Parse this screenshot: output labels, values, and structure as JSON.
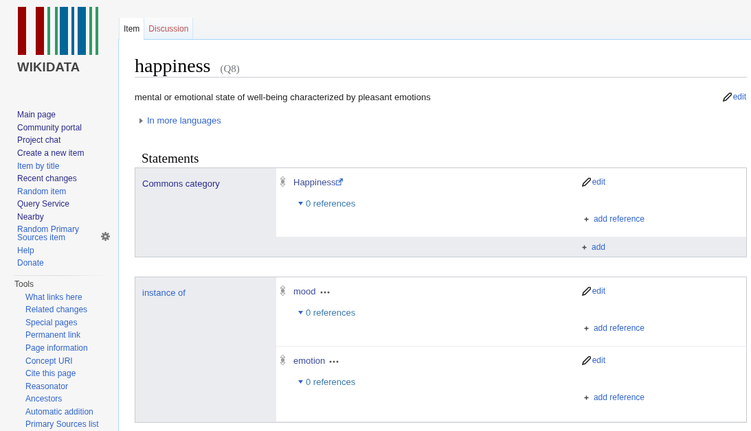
{
  "logo": {
    "text": "WIKIDATA"
  },
  "nav": [
    {
      "label": "Main page",
      "visited": true
    },
    {
      "label": "Community portal",
      "visited": true
    },
    {
      "label": "Project chat",
      "visited": true
    },
    {
      "label": "Create a new item",
      "visited": true
    },
    {
      "label": "Item by title",
      "visited": false
    },
    {
      "label": "Recent changes",
      "visited": true
    },
    {
      "label": "Random item",
      "visited": false
    },
    {
      "label": "Query Service",
      "visited": true
    },
    {
      "label": "Nearby",
      "visited": true
    },
    {
      "label": "Random Primary Sources item",
      "visited": false,
      "gear": true
    },
    {
      "label": "Help",
      "visited": false
    },
    {
      "label": "Donate",
      "visited": false
    }
  ],
  "tools": {
    "heading": "Tools",
    "items": [
      {
        "label": "What links here"
      },
      {
        "label": "Related changes"
      },
      {
        "label": "Special pages"
      },
      {
        "label": "Permanent link"
      },
      {
        "label": "Page information"
      },
      {
        "label": "Concept URI"
      },
      {
        "label": "Cite this page"
      },
      {
        "label": "Reasonator"
      },
      {
        "label": "Ancestors"
      },
      {
        "label": "Automatic addition"
      },
      {
        "label": "Primary Sources list"
      }
    ]
  },
  "tabs": [
    {
      "label": "Item",
      "selected": true,
      "exists": true
    },
    {
      "label": "Discussion",
      "selected": false,
      "exists": false
    }
  ],
  "title": {
    "label": "happiness",
    "id": "(Q8)"
  },
  "description": {
    "text": "mental or emotional state of well-being characterized by pleasant emotions",
    "edit": "edit"
  },
  "more_languages": "In more languages",
  "statements": {
    "heading": "Statements",
    "groups": [
      {
        "property": "Commons category",
        "visited": true,
        "add": "add",
        "statements": [
          {
            "value": "Happiness",
            "external": true,
            "menu": false,
            "references": "0 references",
            "edit": "edit",
            "add_reference": "add reference"
          }
        ]
      },
      {
        "property": "instance of",
        "visited": false,
        "statements": [
          {
            "value": "mood",
            "external": false,
            "menu": true,
            "references": "0 references",
            "edit": "edit",
            "add_reference": "add reference"
          },
          {
            "value": "emotion",
            "external": false,
            "menu": true,
            "references": "0 references",
            "edit": "edit",
            "add_reference": "add reference"
          }
        ]
      }
    ]
  }
}
